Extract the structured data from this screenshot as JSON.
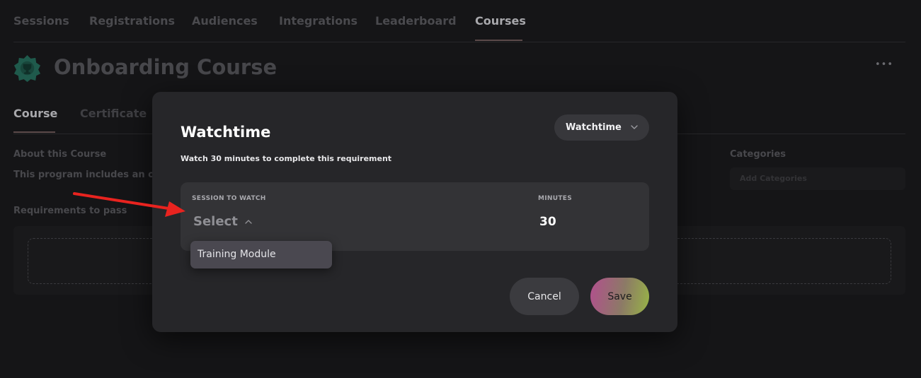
{
  "top_nav": {
    "tabs": [
      "Sessions",
      "Registrations",
      "Audiences",
      "Integrations",
      "Leaderboard",
      "Courses"
    ],
    "active_tab": "Courses"
  },
  "page": {
    "title": "Onboarding Course",
    "more_icon": "ellipsis-icon",
    "course_icon": "trophy-badge-icon"
  },
  "sub_tabs": [
    "Course",
    "Certificate"
  ],
  "about": {
    "label": "About this Course",
    "text": "This program includes an ov"
  },
  "requirements": {
    "label": "Requirements to pass"
  },
  "categories": {
    "label": "Categories",
    "placeholder": "Add Categories"
  },
  "modal": {
    "title": "Watchtime",
    "subtitle": "Watch 30 minutes to complete this requirement",
    "type_dropdown": {
      "value": "Watchtime",
      "icon": "chevron-down-icon"
    },
    "session_field": {
      "label": "SESSION TO WATCH",
      "value": "Select",
      "icon": "chevron-up-icon",
      "options": [
        "Training Module"
      ]
    },
    "minutes_field": {
      "label": "MINUTES",
      "value": "30"
    },
    "buttons": {
      "cancel": "Cancel",
      "save": "Save"
    }
  },
  "colors": {
    "background": "#151517",
    "modal_bg": "#262629",
    "save_gradient_start": "#b24f8e",
    "save_gradient_end": "#98b446",
    "annotation_arrow": "#e8231f"
  }
}
